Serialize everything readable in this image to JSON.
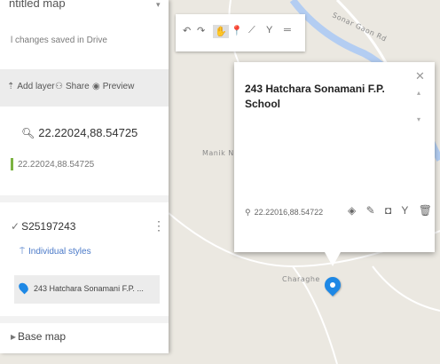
{
  "panel": {
    "title": "ntitled map",
    "title_caret": "▾",
    "saved_status": "l changes saved in Drive",
    "toolbar": {
      "add_layer": "Add layer",
      "share": "Share",
      "preview": "Preview"
    },
    "search": {
      "query": "22.22024,88.54725",
      "result": "22.22024,88.54725"
    },
    "layer": {
      "name": "S25197243",
      "styles_label": "Individual styles",
      "place_label": "243 Hatchara Sonamani F.P. ..."
    },
    "base_map_label": "Base map"
  },
  "map": {
    "labels": [
      "Manik N",
      "Charaghe"
    ],
    "road_label": "Sonar Gaon Rd"
  },
  "popup": {
    "title": "243 Hatchara Sonamani F.P. School",
    "coordinates": "22.22016,88.54722"
  },
  "colors": {
    "accent": "#1e88e5",
    "link": "#4a79c8",
    "river": "#b3cdf2"
  }
}
